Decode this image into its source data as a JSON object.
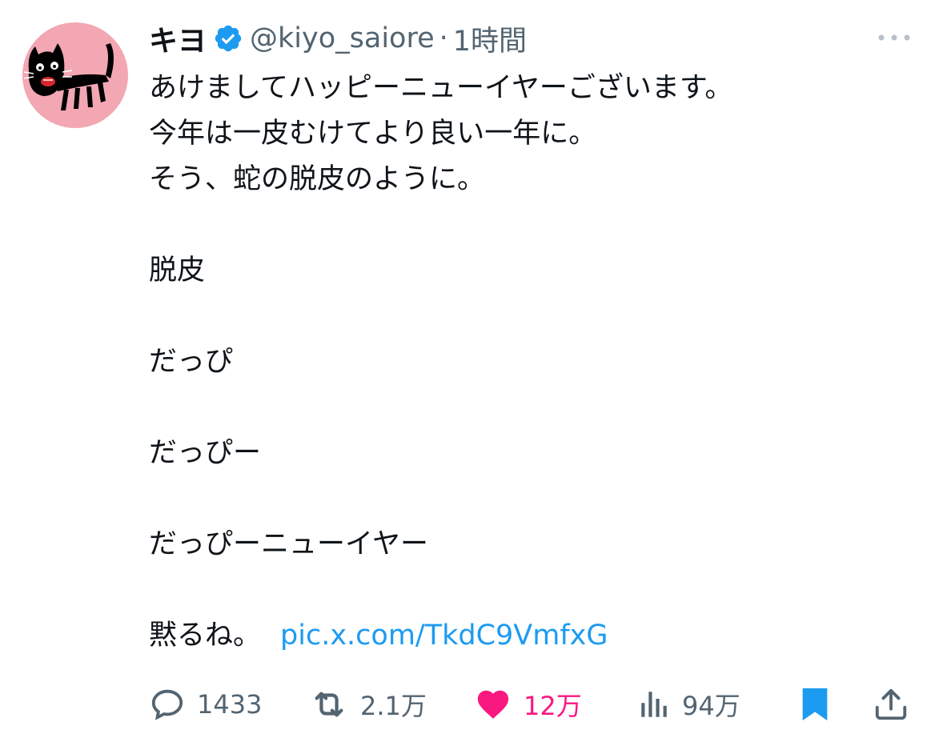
{
  "colors": {
    "text": "#0f1419",
    "secondary": "#536471",
    "link": "#1d9bf0",
    "like": "#f91880",
    "verified": "#1d9bf0",
    "avatar_bg": "#f2a7b3",
    "bookmark": "#1d9bf0"
  },
  "tweet": {
    "display_name": "キヨ",
    "handle": "@kiyo_saiore",
    "separator": "·",
    "time": "1時間",
    "lines": [
      "あけましてハッピーニューイヤーございます。",
      "今年は一皮むけてより良い一年に。",
      "そう、蛇の脱皮のように。",
      "",
      "脱皮",
      "",
      "だっぴ",
      "",
      "だっぴー",
      "",
      "だっぴーニューイヤー",
      "",
      "黙るね。"
    ],
    "link_text": "pic.x.com/TkdC9VmfxG"
  },
  "actions": {
    "replies": "1433",
    "reposts": "2.1万",
    "likes": "12万",
    "views": "94万"
  },
  "icons": {
    "verified": "verified-badge-icon",
    "more": "more-icon",
    "reply": "reply-icon",
    "repost": "repost-icon",
    "like": "heart-icon",
    "views": "views-icon",
    "bookmark": "bookmark-icon",
    "share": "share-icon"
  }
}
